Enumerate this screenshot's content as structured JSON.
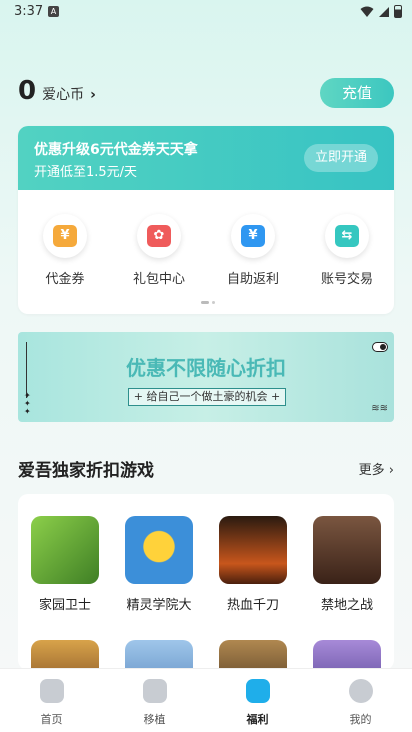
{
  "status_bar": {
    "time": "3:37",
    "notification_icon": "A"
  },
  "coins": {
    "value": "0",
    "label": "爱心币",
    "chevron": "›"
  },
  "recharge_button": "充值",
  "promo": {
    "title": "优惠升级6元代金券天天拿",
    "subtitle": "开通低至1.5元/天",
    "button": "立即开通"
  },
  "services": [
    {
      "label": "代金券",
      "icon": "voucher-icon",
      "glyph": "¥",
      "color": "#f5a93b"
    },
    {
      "label": "礼包中心",
      "icon": "gift-icon",
      "glyph": "✿",
      "color": "#ef5b5b"
    },
    {
      "label": "自助返利",
      "icon": "rebate-icon",
      "glyph": "¥",
      "color": "#2f97f1"
    },
    {
      "label": "账号交易",
      "icon": "trade-icon",
      "glyph": "⇆",
      "color": "#35c7c0"
    }
  ],
  "banner": {
    "title": "优惠不限随心折扣",
    "subtitle": "+ 给自己一个做土豪的机会 +"
  },
  "section": {
    "title": "爱吾独家折扣游戏",
    "more": "更多 ›"
  },
  "games_row1": [
    {
      "name": "家园卫士",
      "color": "#5aa33c"
    },
    {
      "name": "精灵学院大",
      "color": "#3c8fd9"
    },
    {
      "name": "热血千刀",
      "color": "#8a3b1c"
    },
    {
      "name": "禁地之战",
      "color": "#6a3a2a"
    }
  ],
  "games_row2": [
    {
      "color": "#b97a3a"
    },
    {
      "color": "#6fa6d8"
    },
    {
      "color": "#7a5a3a"
    },
    {
      "color": "#6b4fa0"
    }
  ],
  "tabbar": [
    {
      "label": "首页",
      "icon": "home-icon",
      "active": false
    },
    {
      "label": "移植",
      "icon": "gamepad-icon",
      "active": false
    },
    {
      "label": "福利",
      "icon": "welfare-icon",
      "active": true
    },
    {
      "label": "我的",
      "icon": "profile-icon",
      "active": false
    }
  ],
  "colors": {
    "accent": "#3cc7c0",
    "active_tab": "#1faeea"
  }
}
